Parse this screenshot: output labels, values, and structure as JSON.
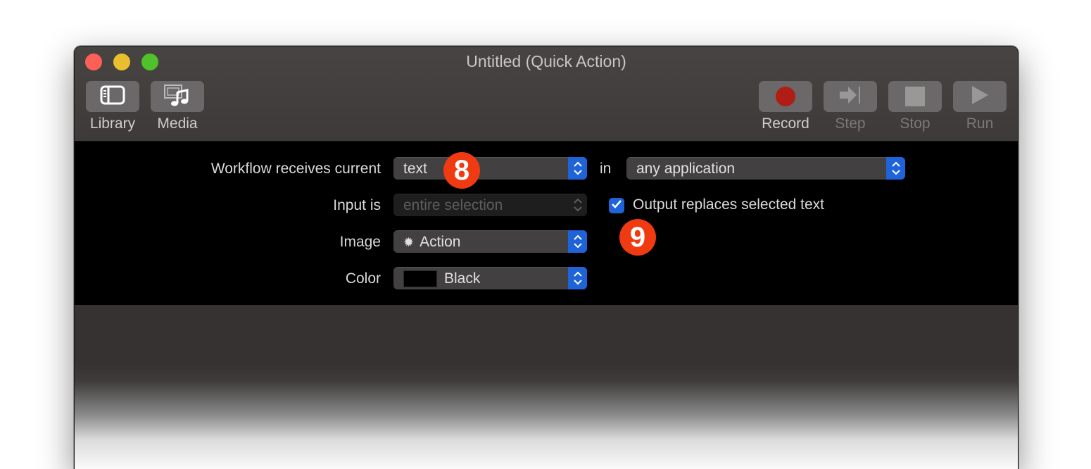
{
  "window": {
    "title": "Untitled (Quick Action)",
    "traffic_lights": {
      "close_color": "#fe5f57",
      "minimize_color": "#e9bf2f",
      "zoom_color": "#4fc12b"
    }
  },
  "toolbar": {
    "left": [
      {
        "label": "Library",
        "icon": "sidebar-icon"
      },
      {
        "label": "Media",
        "icon": "media-icon"
      }
    ],
    "right": [
      {
        "label": "Record",
        "icon": "record-icon",
        "enabled": true
      },
      {
        "label": "Step",
        "icon": "step-icon",
        "enabled": false
      },
      {
        "label": "Stop",
        "icon": "stop-icon",
        "enabled": false
      },
      {
        "label": "Run",
        "icon": "run-icon",
        "enabled": false
      }
    ]
  },
  "config": {
    "receives_label": "Workflow receives current",
    "receives_value": "text",
    "in_label": "in",
    "application_value": "any application",
    "input_label": "Input is",
    "input_value": "entire selection",
    "output_replaces_label": "Output replaces selected text",
    "output_replaces_checked": true,
    "image_label": "Image",
    "image_value": "Action",
    "image_icon": "gear-icon",
    "color_label": "Color",
    "color_value": "Black",
    "color_swatch": "#000000",
    "accent_color": "#1e63d8"
  },
  "annotations": [
    {
      "number": "8",
      "color": "#f03a12"
    },
    {
      "number": "9",
      "color": "#f03a12"
    }
  ]
}
